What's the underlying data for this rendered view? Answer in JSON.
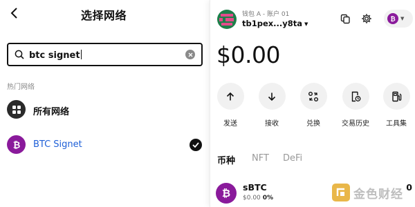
{
  "left": {
    "title": "选择网络",
    "search": {
      "value": "btc signet"
    },
    "section_label": "热门网络",
    "networks": [
      {
        "label": "所有网络",
        "icon": "grid-icon",
        "selected": false
      },
      {
        "label": "BTC Signet",
        "icon": "bitcoin-icon",
        "selected": true
      }
    ]
  },
  "wallet": {
    "account": "钱包 A - 账户 01",
    "address": "tb1pex...y8ta",
    "balance": "$0.00",
    "actions": [
      {
        "label": "发送",
        "icon": "arrow-up-icon"
      },
      {
        "label": "接收",
        "icon": "arrow-down-icon"
      },
      {
        "label": "兑换",
        "icon": "swap-icon"
      },
      {
        "label": "交易历史",
        "icon": "history-icon"
      },
      {
        "label": "工具集",
        "icon": "toolkit-icon"
      }
    ],
    "tabs": [
      "币种",
      "NFT",
      "DeFi"
    ],
    "active_tab": "币种",
    "assets": [
      {
        "name": "sBTC",
        "value": "$0.00",
        "change": "0%",
        "amount": "0"
      }
    ]
  },
  "watermark": {
    "text": "金色财经"
  },
  "colors": {
    "btc_purple": "#8a1a9b",
    "link_blue": "#1e5fd7",
    "avatar_green": "#1d7f4a",
    "watermark_gold": "#e8b13a"
  }
}
